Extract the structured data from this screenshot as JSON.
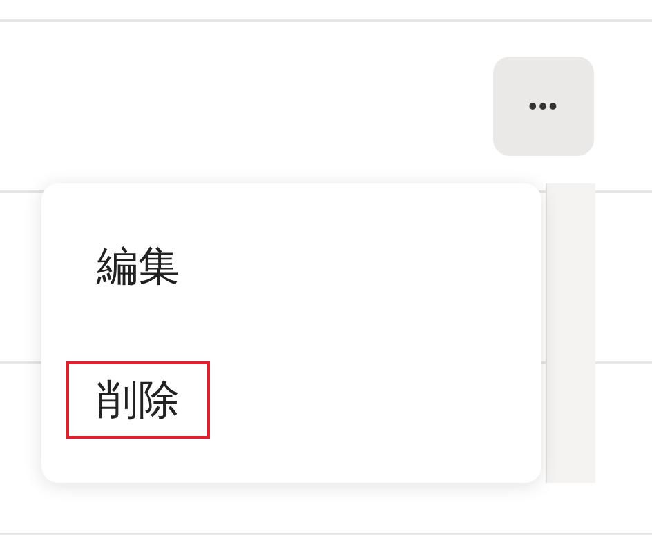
{
  "more_button": {
    "label": "•••"
  },
  "menu": {
    "items": [
      {
        "label": "編集",
        "highlighted": false
      },
      {
        "label": "削除",
        "highlighted": true
      }
    ]
  }
}
